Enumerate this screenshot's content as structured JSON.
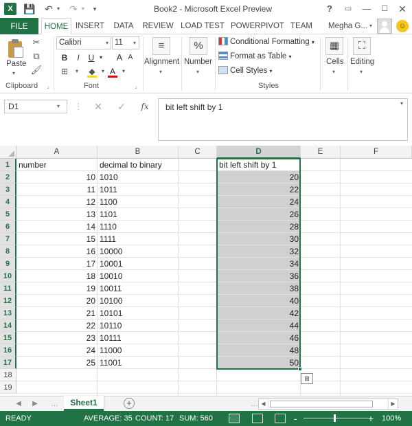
{
  "window": {
    "title": "Book2 - Microsoft Excel Preview",
    "app_logo": "X",
    "help": "?",
    "minimize": "—",
    "restore": "▭",
    "maximize": "☐",
    "close": "✕"
  },
  "qat": {
    "save_icon": "💾",
    "undo_icon": "↶",
    "redo_icon": "↷",
    "dropdown": "▾",
    "customize": "▾"
  },
  "tabs": {
    "file": "FILE",
    "items": [
      "HOME",
      "INSERT",
      "DATA",
      "REVIEW",
      "LOAD TEST",
      "POWERPIVOT",
      "TEAM"
    ],
    "user": "Megha G...",
    "user_dropdown": "▾"
  },
  "ribbon": {
    "clipboard": {
      "label": "Clipboard",
      "paste": "Paste",
      "dropdown": "▾",
      "cut_icon": "✂",
      "copy_icon": "⧉",
      "painter_icon": "🖌"
    },
    "font": {
      "label": "Font",
      "name": "Calibri",
      "size": "11",
      "bold": "B",
      "italic": "I",
      "underline": "U",
      "grow": "A",
      "shrink": "A",
      "border_icon": "⊞",
      "fill_icon": "◆",
      "color_icon": "A",
      "dropdown": "▾"
    },
    "alignment": {
      "label": "Alignment",
      "icon": "≡"
    },
    "number": {
      "label": "Number",
      "icon": "%"
    },
    "styles": {
      "label": "Styles",
      "conditional": "Conditional Formatting",
      "format_table": "Format as Table",
      "cell_styles": "Cell Styles",
      "dropdown": "▾"
    },
    "cells": {
      "label": "Cells",
      "icon": "▦"
    },
    "editing": {
      "label": "Editing",
      "icon": "⛶"
    },
    "launcher": "⌟"
  },
  "formula_bar": {
    "name_box": "D1",
    "name_dropdown": "▾",
    "dots": "⋮",
    "cancel": "✕",
    "enter": "✓",
    "fx": "fx",
    "content": "bit left shift by 1",
    "expand": "▾"
  },
  "grid": {
    "columns": [
      "A",
      "B",
      "C",
      "D",
      "E",
      "F"
    ],
    "rows": [
      "1",
      "2",
      "3",
      "4",
      "5",
      "6",
      "7",
      "8",
      "9",
      "10",
      "11",
      "12",
      "13",
      "14",
      "15",
      "16",
      "17",
      "18",
      "19"
    ],
    "headers": {
      "a": "number",
      "b": "decimal to binary",
      "d": "bit left shift by 1"
    },
    "data": [
      [
        "10",
        "1010",
        "20"
      ],
      [
        "11",
        "1011",
        "22"
      ],
      [
        "12",
        "1100",
        "24"
      ],
      [
        "13",
        "1101",
        "26"
      ],
      [
        "14",
        "1110",
        "28"
      ],
      [
        "15",
        "1111",
        "30"
      ],
      [
        "16",
        "10000",
        "32"
      ],
      [
        "17",
        "10001",
        "34"
      ],
      [
        "18",
        "10010",
        "36"
      ],
      [
        "19",
        "10011",
        "38"
      ],
      [
        "20",
        "10100",
        "40"
      ],
      [
        "21",
        "10101",
        "42"
      ],
      [
        "22",
        "10110",
        "44"
      ],
      [
        "23",
        "10111",
        "46"
      ],
      [
        "24",
        "11000",
        "48"
      ],
      [
        "25",
        "11001",
        "50"
      ]
    ],
    "quick_analysis_icon": "⊞"
  },
  "sheets": {
    "nav_prev": "◀",
    "nav_next": "▶",
    "dots": "…",
    "active": "Sheet1",
    "add": "+",
    "scroll_left": "◀",
    "scroll_right": "▶"
  },
  "status": {
    "mode": "READY",
    "average": "AVERAGE: 35",
    "count": "COUNT: 17",
    "sum": "SUM: 560",
    "zoom_minus": "-",
    "zoom_plus": "+",
    "zoom": "100%"
  },
  "colors": {
    "accent": "#217346",
    "selection": "#d0d0d0"
  }
}
